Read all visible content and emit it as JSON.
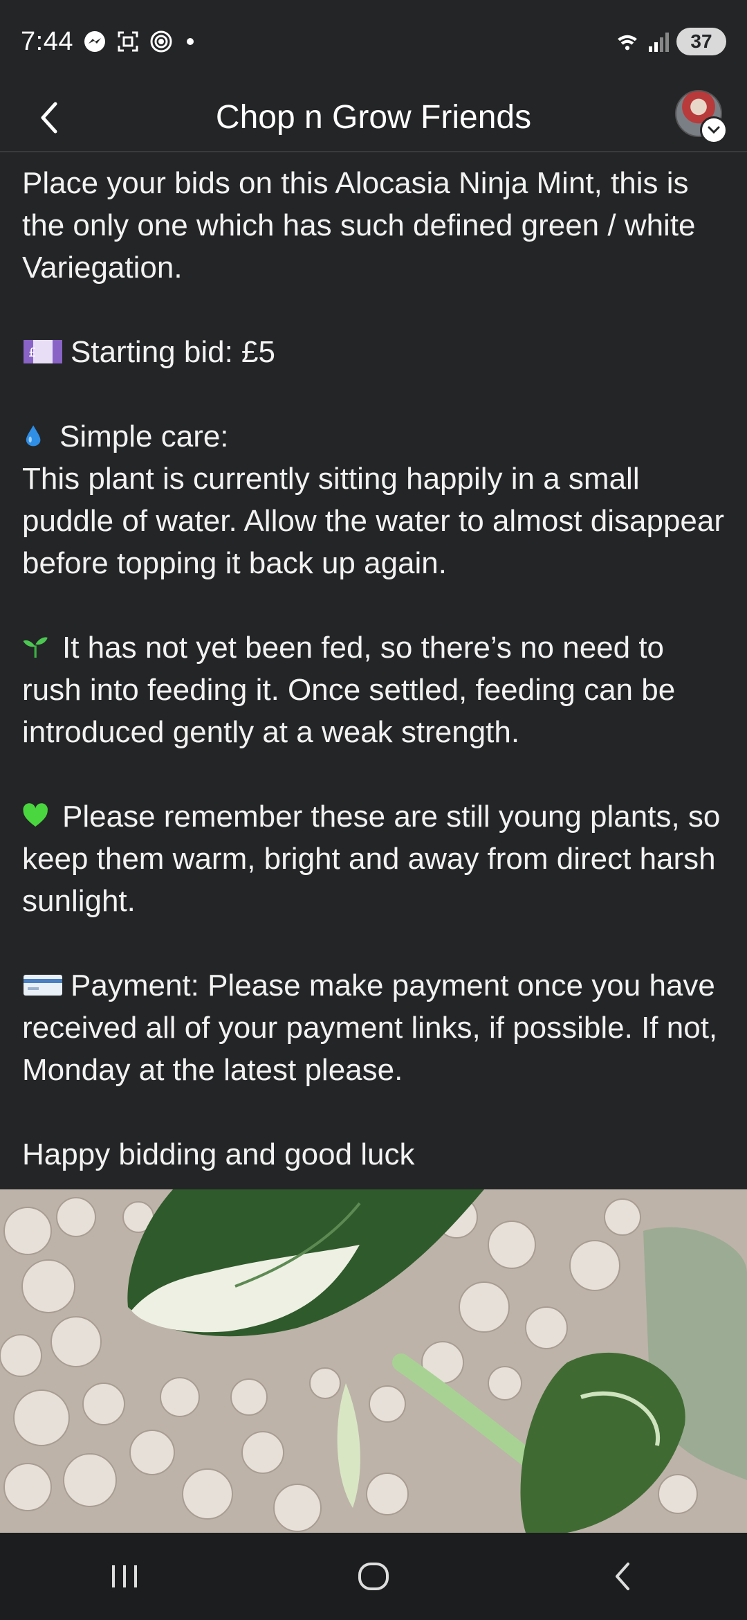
{
  "status_bar": {
    "time": "7:44",
    "battery": "37",
    "icons": [
      "messenger-icon",
      "screenshot-icon",
      "hotspot-icon",
      "wifi-icon",
      "signal-icon"
    ]
  },
  "header": {
    "title": "Chop n Grow Friends",
    "back_icon": "chevron-left-icon"
  },
  "post": {
    "intro": "Place your bids on this Alocasia Ninja Mint, this is the only one which has such defined green / white Variegation.",
    "starting_bid": "Starting bid: £5",
    "care_heading": "Simple care:",
    "care_text": "This plant is currently sitting happily in a small puddle of water. Allow the water to almost disappear before topping it back up again.",
    "feeding": "It has not yet been fed, so there’s no need to rush into feeding it. Once settled, feeding can be introduced gently at a weak strength.",
    "reminder": "Please remember these are still young plants, so keep them warm, bright and away from direct harsh sunlight.",
    "payment": "Payment: Please make payment once you have received all of your payment links, if possible. If not, Monday at the latest please.",
    "closing": "Happy bidding and good luck"
  },
  "nav_bar": {
    "icons": [
      "recent-apps-icon",
      "home-icon",
      "back-icon"
    ]
  },
  "colors": {
    "background": "#242527",
    "text": "#f2f2f2",
    "nav": "#1c1d1f"
  }
}
